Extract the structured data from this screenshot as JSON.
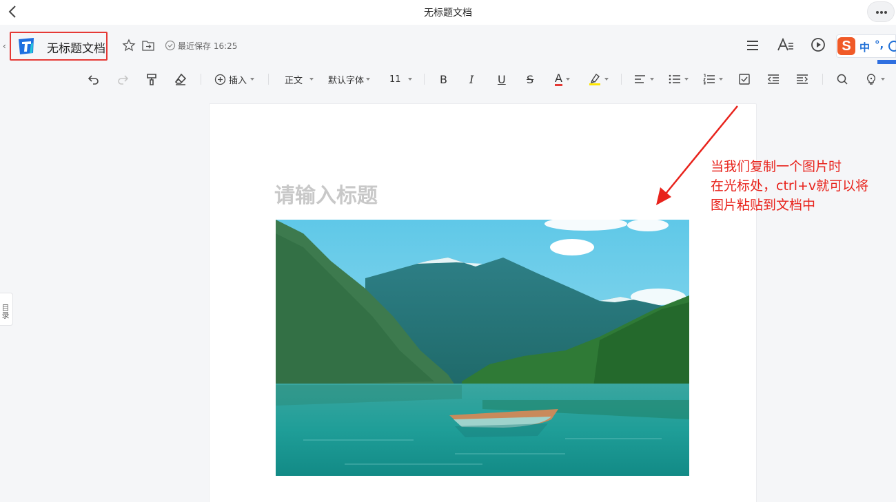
{
  "window": {
    "title": "无标题文档"
  },
  "doc": {
    "name": "无标题文档",
    "save_status": "最近保存 16:25"
  },
  "toolbar": {
    "insert_label": "插入",
    "style_label": "正文",
    "font_label": "默认字体",
    "size_label": "11",
    "bold": "B",
    "italic": "I",
    "underline": "U",
    "strike": "S",
    "font_color_glyph": "A"
  },
  "ime": {
    "zh": "中",
    "punct": "°,"
  },
  "sidebar": {
    "outline_label": "目录"
  },
  "page": {
    "title_placeholder": "请输入标题"
  },
  "annotation": {
    "line1": "当我们复制一个图片时",
    "line2": "在光标处，ctrl+v就可以将",
    "line3": "图片粘贴到文档中"
  },
  "colors": {
    "annotation": "#e8231c",
    "accent": "#2f6fe0",
    "highlight": "#ffe600"
  }
}
